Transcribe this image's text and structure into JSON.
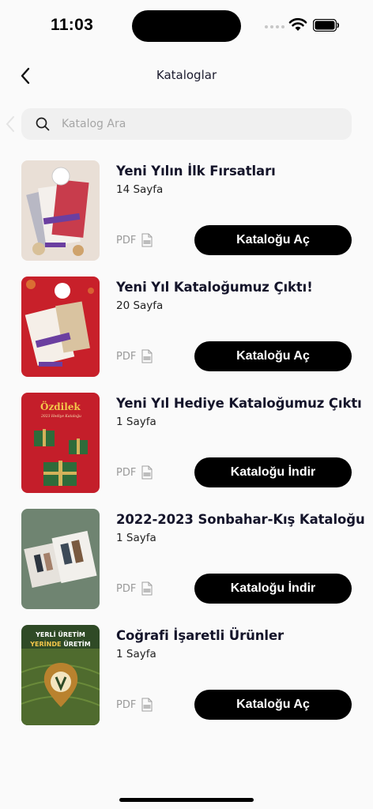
{
  "status_bar": {
    "time": "11:03"
  },
  "header": {
    "title": "Kataloglar"
  },
  "search": {
    "placeholder": "Katalog Ara"
  },
  "catalogs": [
    {
      "title": "Yeni Yılın İlk Fırsatları",
      "pages": "14 Sayfa",
      "format": "PDF",
      "action": "Kataloğu Aç"
    },
    {
      "title": "Yeni Yıl Kataloğumuz Çıktı!",
      "pages": "20 Sayfa",
      "format": "PDF",
      "action": "Kataloğu Aç"
    },
    {
      "title": "Yeni Yıl Hediye Kataloğumuz Çıktı",
      "pages": "1 Sayfa",
      "format": "PDF",
      "action": "Kataloğu İndir"
    },
    {
      "title": "2022-2023 Sonbahar-Kış Kataloğu",
      "pages": "1 Sayfa",
      "format": "PDF",
      "action": "Kataloğu İndir"
    },
    {
      "title": "Coğrafi İşaretli Ürünler",
      "pages": "1 Sayfa",
      "format": "PDF",
      "action": "Kataloğu Aç"
    }
  ],
  "thumb_text": {
    "cover3_brand": "Özdilek",
    "cover3_caption": "2023 Hediye Kataloğu",
    "cover5_line1": "YERLİ ÜRETİM",
    "cover5_line2_a": "YERİNDE",
    "cover5_line2_b": " ÜRETİM"
  },
  "colors": {
    "button": "#000000",
    "search_bg": "#f0f0f0",
    "cover_red": "#c8202a",
    "cover_green": "#6f8471"
  }
}
